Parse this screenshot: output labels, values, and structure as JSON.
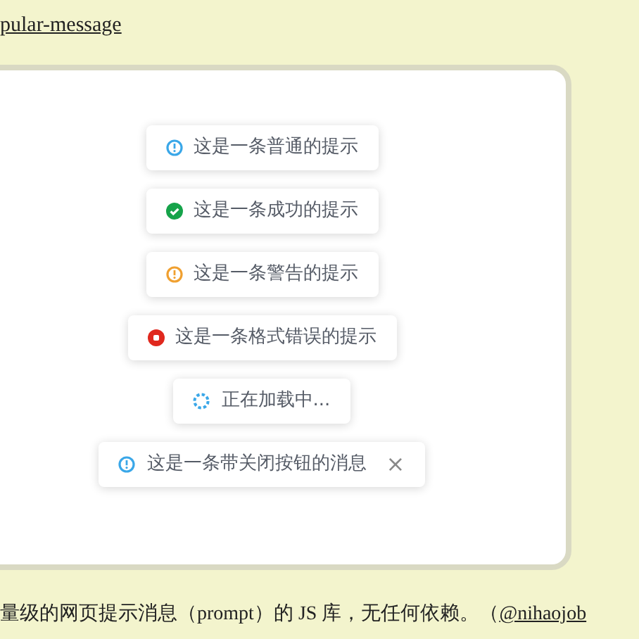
{
  "top_link": {
    "text": "pular-message"
  },
  "messages": [
    {
      "kind": "info",
      "text": "这是一条普通的提示"
    },
    {
      "kind": "success",
      "text": "这是一条成功的提示"
    },
    {
      "kind": "warning",
      "text": "这是一条警告的提示"
    },
    {
      "kind": "error",
      "text": "这是一条格式错误的提示"
    },
    {
      "kind": "loading",
      "text": "正在加载中..."
    },
    {
      "kind": "info",
      "text": "这是一条带关闭按钮的消息",
      "close": "×"
    }
  ],
  "description": {
    "text": "量级的网页提示消息（prompt）的 JS 库，无任何依赖。（",
    "link": "@nihaojob"
  }
}
